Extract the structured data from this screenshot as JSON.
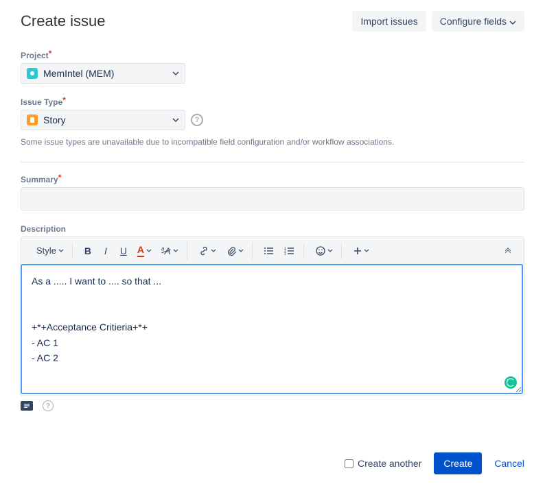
{
  "header": {
    "title": "Create issue",
    "import_label": "Import issues",
    "configure_label": "Configure fields"
  },
  "project": {
    "label": "Project",
    "value": "MemIntel (MEM)"
  },
  "issue_type": {
    "label": "Issue Type",
    "value": "Story",
    "hint": "Some issue types are unavailable due to incompatible field configuration and/or workflow associations."
  },
  "summary": {
    "label": "Summary",
    "value": ""
  },
  "description": {
    "label": "Description",
    "toolbar": {
      "style": "Style"
    },
    "text": "As a ..... I want to .... so that ...\n\n\n+*+Acceptance Critieria+*+\n- AC 1\n- AC 2"
  },
  "footer": {
    "create_another": "Create another",
    "create": "Create",
    "cancel": "Cancel"
  }
}
